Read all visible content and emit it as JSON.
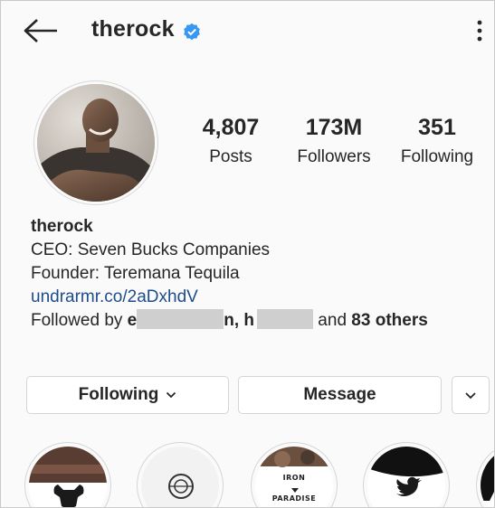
{
  "header": {
    "username": "therock",
    "icons": {
      "back": "arrow-left-icon",
      "verified": "verified-badge-icon",
      "more": "more-vertical-icon"
    }
  },
  "stats": {
    "posts": {
      "value": "4,807",
      "label": "Posts"
    },
    "followers": {
      "value": "173M",
      "label": "Followers"
    },
    "following": {
      "value": "351",
      "label": "Following"
    }
  },
  "bio": {
    "name": "therock",
    "line1": "CEO: Seven Bucks Companies",
    "line2": "Founder: Teremana Tequila",
    "link": "undrarmr.co/2aDxhdV",
    "followed_prefix": "Followed by ",
    "followed_a_start": "e",
    "followed_a_end": "n",
    "followed_sep": ", ",
    "followed_b_start": "h",
    "followed_and": " and ",
    "followed_count": "83 others"
  },
  "buttons": {
    "following": "Following",
    "message": "Message"
  },
  "highlights": [
    {
      "name": "bull-logo"
    },
    {
      "name": "teremana-logo"
    },
    {
      "name": "iron-paradise",
      "text_top": "IRON",
      "text_bottom": "PARADISE"
    },
    {
      "name": "twitter-logo"
    },
    {
      "name": "partial"
    }
  ],
  "colors": {
    "link": "#1d4c8b",
    "verified": "#3897f0",
    "background": "#fafafa"
  }
}
